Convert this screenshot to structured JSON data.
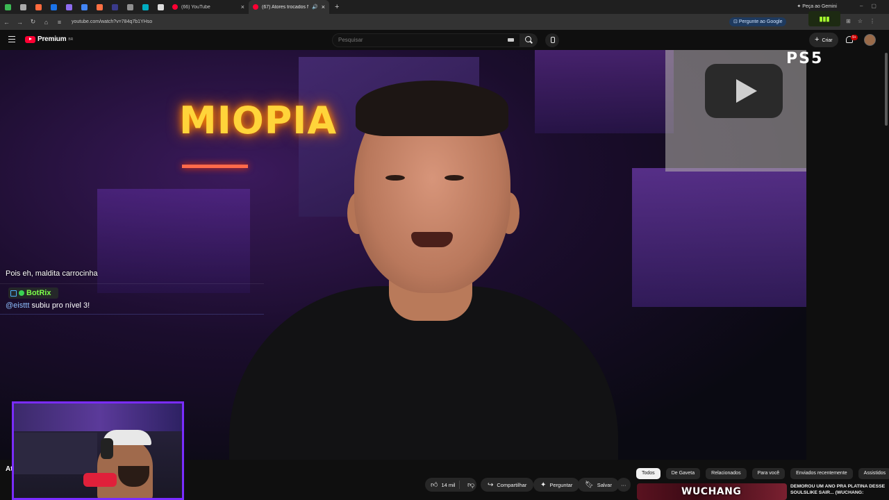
{
  "browser": {
    "pinned_tab_colors": [
      "#3cba54",
      "#aaaaaa",
      "#ff6a3d",
      "#1a73e8",
      "#8e6cef",
      "#4285f4",
      "#ff7043",
      "#3a3a8a",
      "#8f8f8f",
      "#00acc1",
      "#dddddd"
    ],
    "tabs": [
      {
        "title": "(66) YouTube",
        "active": false
      },
      {
        "title": "(67) Atores trocados NO M",
        "active": true
      }
    ],
    "new_tab": "+",
    "gemini_label": "Peça ao Gemini",
    "url": "youtube.com/watch?v=784q7b1YHso",
    "ask_google_label": "Pergunte ao Google"
  },
  "youtube": {
    "logo_text": "Premium",
    "logo_sup": "BR",
    "search_placeholder": "Pesquisar",
    "create_label": "Criar",
    "notifications_badge": "9+"
  },
  "video": {
    "neon_sign": "MIOPIA",
    "ps5_logo": "PS5",
    "chat": {
      "message1": "Pois eh, maldita carrocinha",
      "bot_name": "BotRix",
      "mention": "@eisttt",
      "message2": " subiu pro nível 3!"
    }
  },
  "actions": {
    "title_clip": "At",
    "likes": "14 mil",
    "share": "Compartilhar",
    "ask": "Perguntar",
    "save": "Salvar",
    "more": "···"
  },
  "recommendations": {
    "chips": [
      "Todos",
      "De Gaveta",
      "Relacionados",
      "Para você",
      "Enviados recentemente",
      "Assistidos"
    ],
    "active_chip": 0,
    "first_item": {
      "thumb_text": "WUCHANG",
      "title": "DEMOROU UM ANO PRA PLATINA DESSE SOULSLIKE SAIR... (WUCHANG:"
    }
  }
}
